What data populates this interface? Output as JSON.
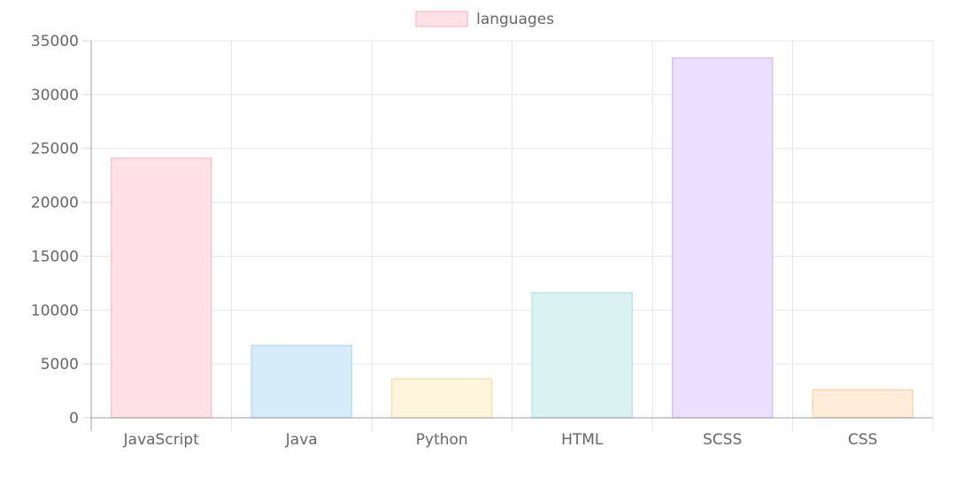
{
  "chart_data": {
    "type": "bar",
    "categories": [
      "JavaScript",
      "Java",
      "Python",
      "HTML",
      "SCSS",
      "CSS"
    ],
    "series": [
      {
        "name": "languages",
        "values": [
          24100,
          6700,
          3600,
          11600,
          33400,
          2600
        ]
      }
    ],
    "bar_fill_colors": [
      "#ffe0e6",
      "#d7ecfb",
      "#fff5dd",
      "#dbf2f2",
      "#ebe0ff",
      "#ffecd9"
    ],
    "bar_border_colors": [
      "#f8c6d0",
      "#b9dcf6",
      "#f5e3b2",
      "#bde6e6",
      "#d3c1f7",
      "#f8d6b2"
    ],
    "legend_color": "#ffe0e6",
    "legend_border_color": "#f8c6d0",
    "legend_position": "top",
    "ylim": [
      0,
      35000
    ],
    "y_ticks": [
      0,
      5000,
      10000,
      15000,
      20000,
      25000,
      30000,
      35000
    ],
    "grid": true
  }
}
